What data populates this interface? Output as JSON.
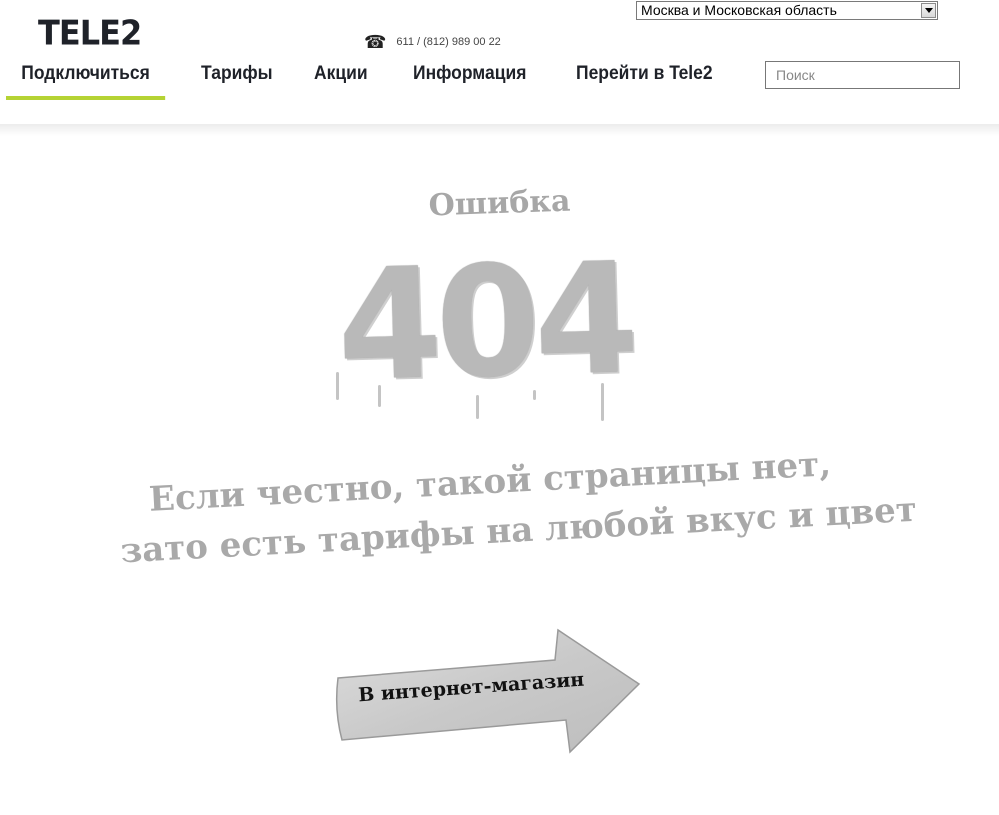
{
  "header": {
    "logo": "TELE2",
    "region": "Москва и Московская область",
    "phone": "611 / (812) 989 00 22",
    "nav": [
      {
        "label": "Подключиться",
        "active": true
      },
      {
        "label": "Тарифы",
        "active": false
      },
      {
        "label": "Акции",
        "active": false
      },
      {
        "label": "Информация",
        "active": false
      },
      {
        "label": "Перейти в Tele2",
        "active": false
      }
    ],
    "search_placeholder": "Поиск"
  },
  "error": {
    "title": "Ошибка",
    "code": "404",
    "message_line1": "Если честно, такой страницы нет,",
    "message_line2": "зато есть тарифы на любой вкус и цвет"
  },
  "cta": {
    "label": "В интернет-магазин"
  },
  "colors": {
    "accent": "#b5d334",
    "text": "#1f2229",
    "stencil": "#a9a9a9"
  },
  "icons": {
    "phone": "phone-icon",
    "dropdown": "chevron-down-icon",
    "cta": "arrow-right-icon"
  }
}
